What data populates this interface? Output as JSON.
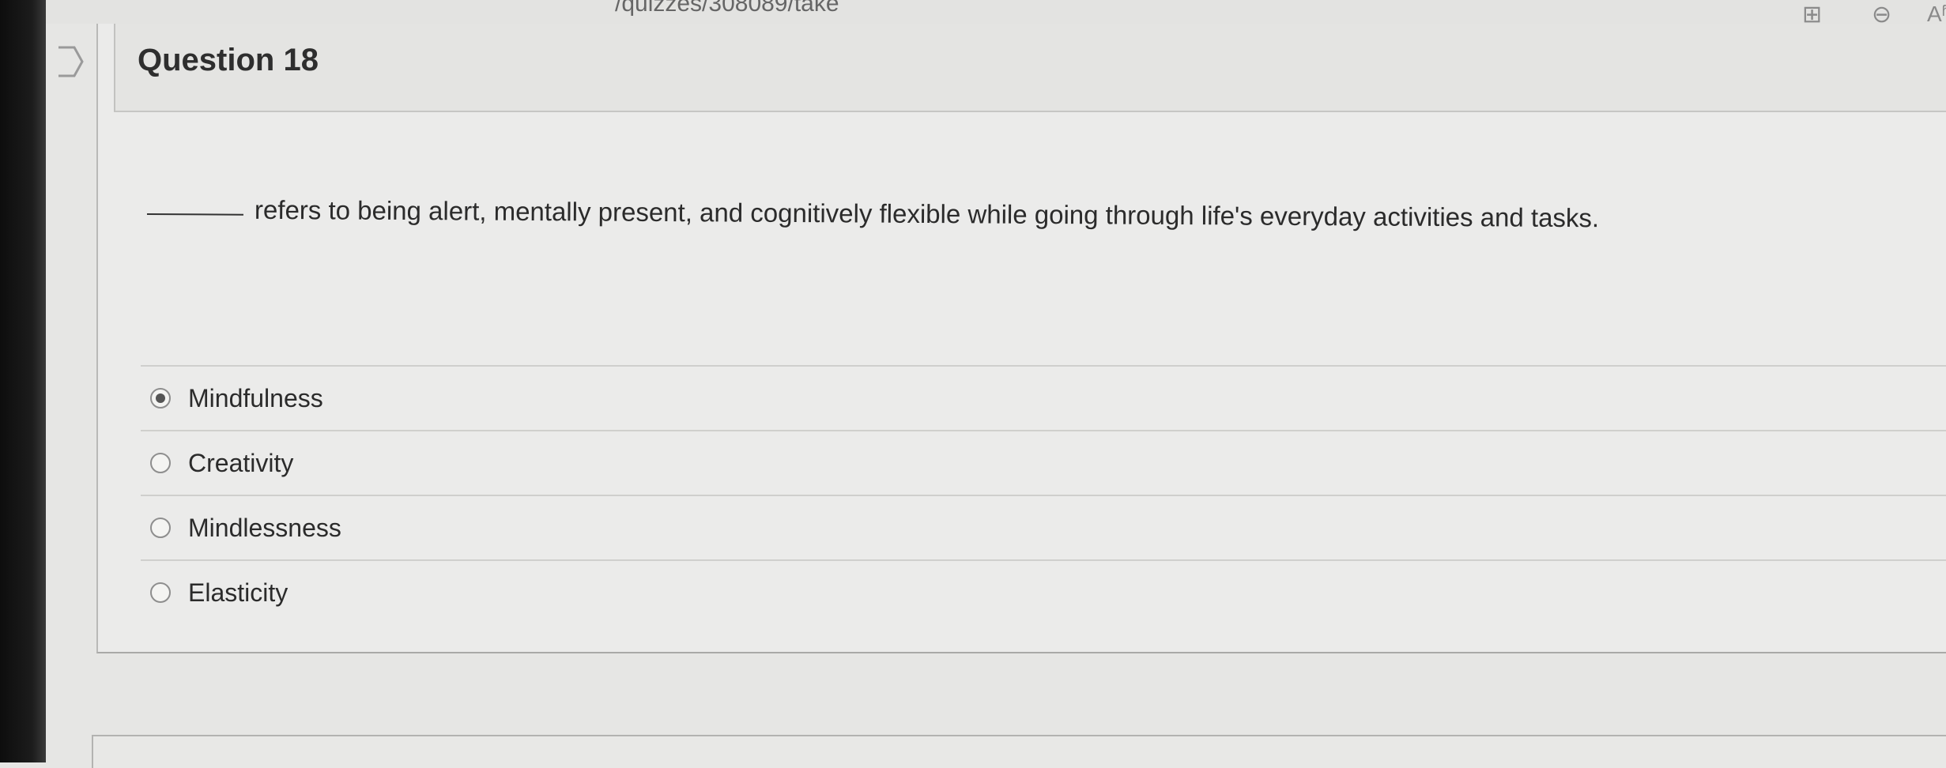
{
  "browser": {
    "url_fragment": "/quizzes/308089/take",
    "toolbar_icons": [
      "apps-icon",
      "zoom-out-icon",
      "read-aloud-icon"
    ]
  },
  "question": {
    "title": "Question 18",
    "text": "refers to being alert, mentally present, and cognitively flexible while going through life's everyday activities and tasks.",
    "answers": [
      {
        "label": "Mindfulness",
        "selected": true
      },
      {
        "label": "Creativity",
        "selected": false
      },
      {
        "label": "Mindlessness",
        "selected": false
      },
      {
        "label": "Elasticity",
        "selected": false
      }
    ]
  }
}
